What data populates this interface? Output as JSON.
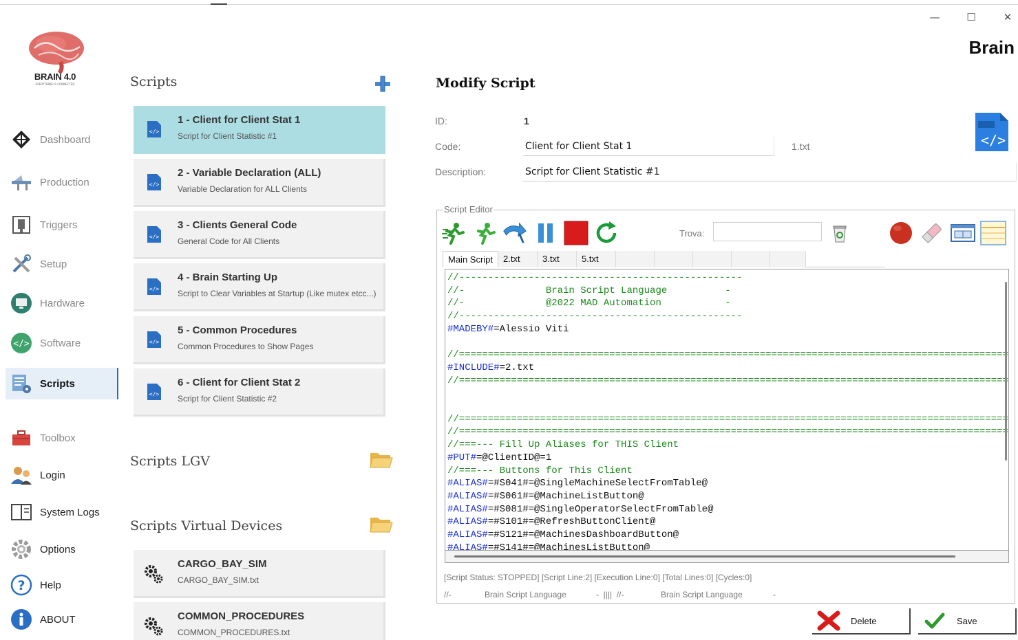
{
  "window": {
    "title": "Brain",
    "minimize_glyph": "—",
    "maximize_glyph": "☐",
    "close_glyph": "✕"
  },
  "logo": {
    "text": "BRAIN 4.0",
    "subtext": "EVERYTHING IS CONNECTED"
  },
  "sidebar": {
    "items": [
      {
        "label": "Dashboard",
        "icon": "dashboard-icon"
      },
      {
        "label": "Production",
        "icon": "production-icon"
      },
      {
        "label": "Triggers",
        "icon": "triggers-icon"
      },
      {
        "label": "Setup",
        "icon": "setup-icon"
      },
      {
        "label": "Hardware",
        "icon": "hardware-icon"
      },
      {
        "label": "Software",
        "icon": "software-icon"
      },
      {
        "label": "Scripts",
        "icon": "scripts-icon",
        "active": true
      },
      {
        "label": "Toolbox",
        "icon": "toolbox-icon"
      },
      {
        "label": "Login",
        "icon": "login-icon"
      },
      {
        "label": "System Logs",
        "icon": "system-logs-icon"
      },
      {
        "label": "Options",
        "icon": "options-icon"
      },
      {
        "label": "Help",
        "icon": "help-icon"
      },
      {
        "label": "ABOUT",
        "icon": "about-icon"
      }
    ]
  },
  "scripts": {
    "title": "Scripts",
    "items": [
      {
        "title": "1 - Client for Client Stat 1",
        "subtitle": "Script for Client Statistic #1",
        "selected": true
      },
      {
        "title": "2 - Variable Declaration (ALL)",
        "subtitle": "Variable Declaration for ALL Clients"
      },
      {
        "title": "3 - Clients General Code",
        "subtitle": "General Code for All Clients"
      },
      {
        "title": "4 - Brain Starting Up",
        "subtitle": "Script to Clear Variables at Startup (Like mutex etcc...)"
      },
      {
        "title": "5 - Common Procedures",
        "subtitle": "Common Procedures to Show Pages"
      },
      {
        "title": "6 - Client for Client Stat 2",
        "subtitle": "Script for Client Statistic #2"
      }
    ]
  },
  "scripts_lgv": {
    "title": "Scripts LGV"
  },
  "scripts_virtual": {
    "title": "Scripts Virtual Devices",
    "items": [
      {
        "title": "CARGO_BAY_SIM",
        "subtitle": "CARGO_BAY_SIM.txt"
      },
      {
        "title": "COMMON_PROCEDURES",
        "subtitle": "COMMON_PROCEDURES.txt"
      }
    ]
  },
  "modify": {
    "title": "Modify Script",
    "id_label": "ID:",
    "id_value": "1",
    "code_label": "Code:",
    "code_value": "Client for Client Stat 1",
    "file_name": "1.txt",
    "description_label": "Description:",
    "description_value": "Script for Client Statistic #1"
  },
  "editor": {
    "legend": "Script Editor",
    "trova_label": "Trova:",
    "trova_value": "",
    "tabs": [
      "Main Script",
      "2.txt",
      "3.txt",
      "5.txt"
    ],
    "active_tab": "Main Script",
    "lines": [
      [
        [
          "cm",
          "//-------------------------------------------------"
        ]
      ],
      [
        [
          "cm",
          "//-              Brain Script Language          -"
        ]
      ],
      [
        [
          "cm",
          "//-              @2022 MAD Automation           -"
        ]
      ],
      [
        [
          "cm",
          "//-------------------------------------------------"
        ]
      ],
      [
        [
          "kw",
          "#MADEBY#"
        ],
        [
          "tx",
          "=Alessio Viti"
        ]
      ],
      [
        [
          "tx",
          ""
        ]
      ],
      [
        [
          "cm",
          "//================================================================================================"
        ]
      ],
      [
        [
          "kw",
          "#INCLUDE#"
        ],
        [
          "tx",
          "=2.txt"
        ]
      ],
      [
        [
          "cm",
          "//================================================================================================"
        ]
      ],
      [
        [
          "tx",
          ""
        ]
      ],
      [
        [
          "tx",
          ""
        ]
      ],
      [
        [
          "cm",
          "//================================================================================================"
        ]
      ],
      [
        [
          "cm",
          "//================================================================================================"
        ]
      ],
      [
        [
          "cm",
          "//===--- Fill Up Aliases for THIS Client"
        ]
      ],
      [
        [
          "kw",
          "#PUT#"
        ],
        [
          "tx",
          "=@ClientID@=1"
        ]
      ],
      [
        [
          "cm",
          "//===--- Buttons for This Client"
        ]
      ],
      [
        [
          "kw",
          "#ALIAS#"
        ],
        [
          "tx",
          "=#S041#=@SingleMachineSelectFromTable@"
        ]
      ],
      [
        [
          "kw",
          "#ALIAS#"
        ],
        [
          "tx",
          "=#S061#=@MachineListButton@"
        ]
      ],
      [
        [
          "kw",
          "#ALIAS#"
        ],
        [
          "tx",
          "=#S081#=@SingleOperatorSelectFromTable@"
        ]
      ],
      [
        [
          "kw",
          "#ALIAS#"
        ],
        [
          "tx",
          "=#S101#=@RefreshButtonClient@"
        ]
      ],
      [
        [
          "kw",
          "#ALIAS#"
        ],
        [
          "tx",
          "=#S121#=@MachinesDashboardButton@"
        ]
      ],
      [
        [
          "kw",
          "#ALIAS#"
        ],
        [
          "tx",
          "=#S141#=@MachinesListButton@"
        ]
      ]
    ],
    "status": "[Script Status: STOPPED] [Script Line:2] [Execution Line:0] [Total Lines:0] [Cycles:0]",
    "status2_prefix": "//-",
    "status2_text1": "Brain Script Language",
    "status2_mid": "-  ||||  //-",
    "status2_text2": "Brain Script Language",
    "status2_suffix": "-"
  },
  "actions": {
    "delete_label": "Delete",
    "save_label": "Save"
  },
  "colors": {
    "accent": "#2c6fb8",
    "selected_card": "#acdde3",
    "comment": "#1c8a1c",
    "keyword": "#1a2fd0"
  }
}
